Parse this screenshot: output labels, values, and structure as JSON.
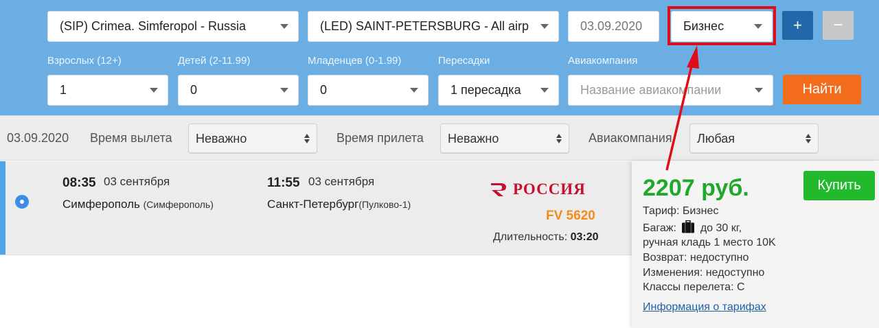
{
  "search": {
    "origin": "(SIP) Crimea. Simferopol - Russia",
    "destination": "(LED) SAINT-PETERSBURG - All airp",
    "date": "03.09.2020",
    "cabin_class": "Бизнес",
    "add_label": "+",
    "remove_label": "−",
    "adults_label": "Взрослых (12+)",
    "adults_value": "1",
    "children_label": "Детей (2-11.99)",
    "children_value": "0",
    "infants_label": "Младенцев (0-1.99)",
    "infants_value": "0",
    "transfers_label": "Пересадки",
    "transfers_value": "1 пересадка",
    "airline_label": "Авиакомпания",
    "airline_placeholder": "Название авиакомпании",
    "find_label": "Найти"
  },
  "filters": {
    "date": "03.09.2020",
    "departure_label": "Время вылета",
    "departure_value": "Неважно",
    "arrival_label": "Время прилета",
    "arrival_value": "Неважно",
    "airline_label": "Авиакомпания",
    "airline_value": "Любая"
  },
  "flight": {
    "dep_time": "08:35",
    "dep_date": "03 сентября",
    "dep_city": "Симферополь",
    "dep_airport": "(Симферополь)",
    "arr_time": "11:55",
    "arr_date": "03 сентября",
    "arr_city": "Санкт-Петербург",
    "arr_airport": "(Пулково-1)",
    "airline_name": "РОССИЯ",
    "flight_number": "FV 5620",
    "duration_label": "Длительность:",
    "duration_value": "03:20"
  },
  "offer": {
    "price": "2207 руб.",
    "buy_label": "Купить",
    "tariff": "Тариф: Бизнес",
    "baggage_prefix": "Багаж:",
    "baggage_suffix": "до 30 кг,",
    "hand_luggage": "ручная кладь 1 место 10K",
    "refund": "Возврат: недоступно",
    "changes": "Изменения: недоступно",
    "classes": "Классы перелета: C",
    "tariff_link": "Информация о тарифах"
  },
  "colors": {
    "panel": "#6aaee3",
    "highlight": "#e00d19",
    "price": "#1fa92b",
    "flight_number": "#f28a1c",
    "find_button": "#f36c1b"
  }
}
